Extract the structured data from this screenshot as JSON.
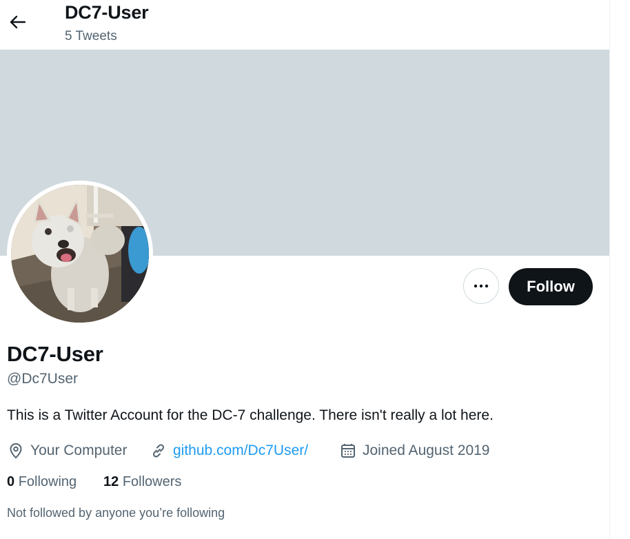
{
  "header": {
    "title": "DC7-User",
    "tweet_count": "5 Tweets"
  },
  "actions": {
    "more_icon": "more-horizontal-icon",
    "follow_label": "Follow"
  },
  "profile": {
    "name": "DC7-User",
    "handle": "@Dc7User",
    "bio": "This is a Twitter Account for the DC-7 challenge. There isn't really a lot here.",
    "location": "Your Computer",
    "website": "github.com/Dc7User/",
    "joined": "Joined August 2019",
    "following_count": "0",
    "following_label": "Following",
    "followers_count": "12",
    "followers_label": "Followers",
    "not_followed_text": "Not followed by anyone you’re following"
  },
  "colors": {
    "banner": "#cfd9de",
    "link": "#1d9bf0",
    "text": "#0f1419",
    "secondary": "#536471",
    "follow_bg": "#0f1419"
  }
}
